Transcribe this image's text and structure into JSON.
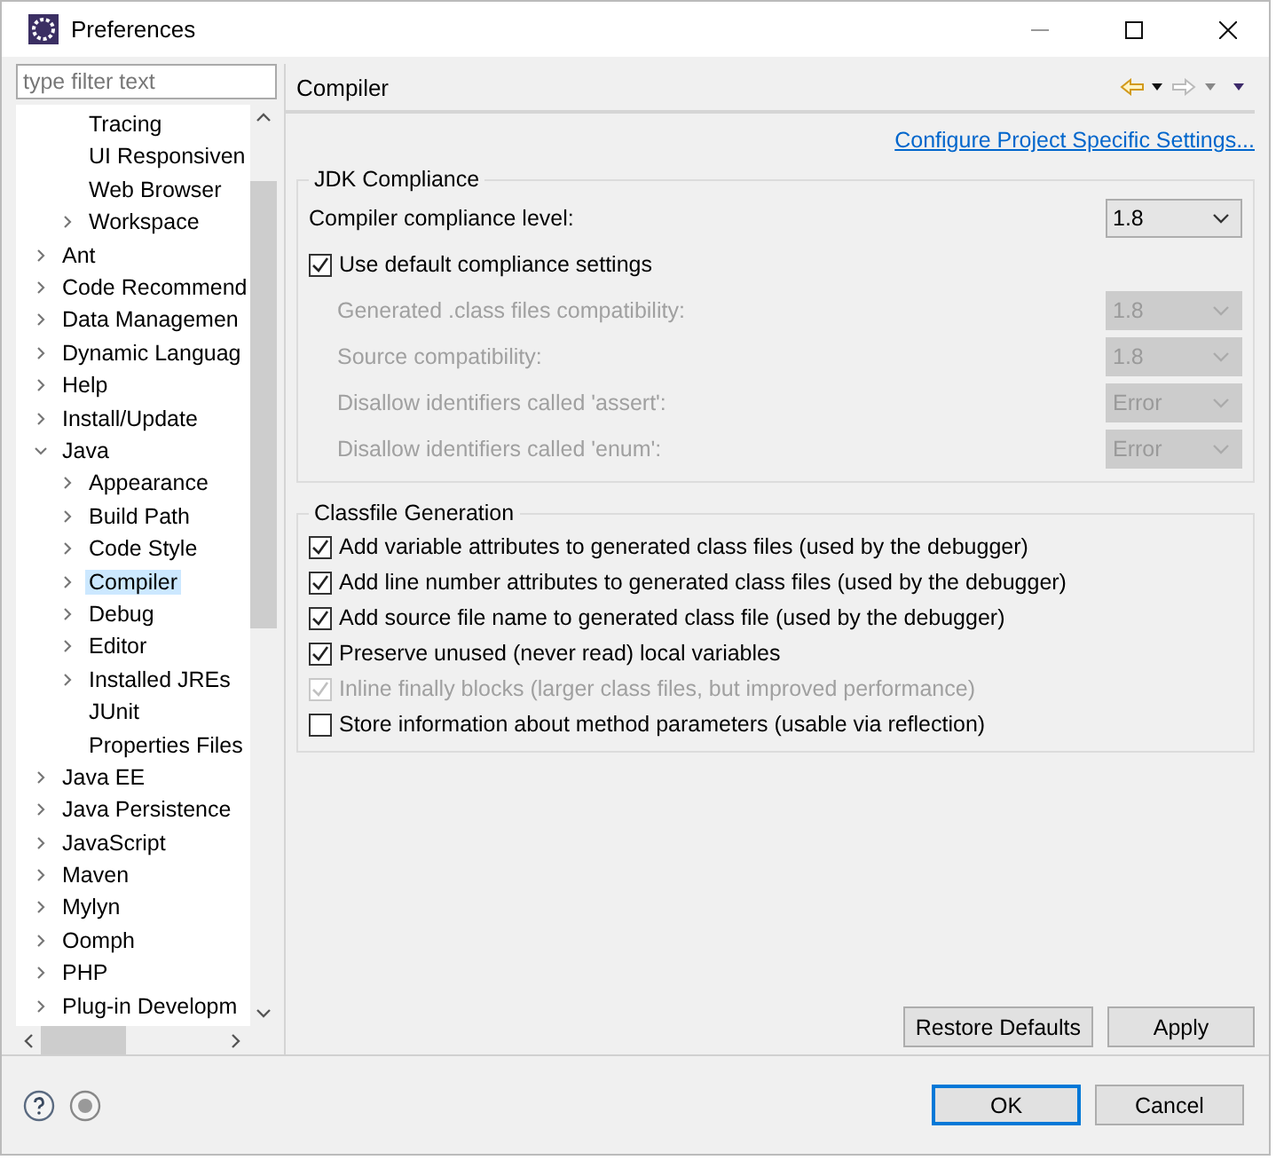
{
  "window": {
    "title": "Preferences"
  },
  "filter": {
    "placeholder": "type filter text"
  },
  "tree": {
    "scrolled_group_items": [
      {
        "label": "Tracing",
        "expandable": false,
        "selected": false
      },
      {
        "label": "UI Responsiven",
        "expandable": false,
        "selected": false
      },
      {
        "label": "Web Browser",
        "expandable": false,
        "selected": false
      },
      {
        "label": "Workspace",
        "expandable": true,
        "expanded": false,
        "selected": false
      }
    ],
    "items": [
      {
        "label": "Ant",
        "expandable": true,
        "expanded": false,
        "selected": false
      },
      {
        "label": "Code Recommend",
        "expandable": true,
        "expanded": false,
        "selected": false
      },
      {
        "label": "Data Managemen",
        "expandable": true,
        "expanded": false,
        "selected": false
      },
      {
        "label": "Dynamic Languag",
        "expandable": true,
        "expanded": false,
        "selected": false
      },
      {
        "label": "Help",
        "expandable": true,
        "expanded": false,
        "selected": false
      },
      {
        "label": "Install/Update",
        "expandable": true,
        "expanded": false,
        "selected": false
      },
      {
        "label": "Java",
        "expandable": true,
        "expanded": true,
        "selected": false,
        "children": [
          {
            "label": "Appearance",
            "expandable": true,
            "expanded": false,
            "selected": false
          },
          {
            "label": "Build Path",
            "expandable": true,
            "expanded": false,
            "selected": false
          },
          {
            "label": "Code Style",
            "expandable": true,
            "expanded": false,
            "selected": false
          },
          {
            "label": "Compiler",
            "expandable": true,
            "expanded": false,
            "selected": true
          },
          {
            "label": "Debug",
            "expandable": true,
            "expanded": false,
            "selected": false
          },
          {
            "label": "Editor",
            "expandable": true,
            "expanded": false,
            "selected": false
          },
          {
            "label": "Installed JREs",
            "expandable": true,
            "expanded": false,
            "selected": false
          },
          {
            "label": "JUnit",
            "expandable": false,
            "selected": false
          },
          {
            "label": "Properties Files",
            "expandable": false,
            "selected": false
          }
        ]
      },
      {
        "label": "Java EE",
        "expandable": true,
        "expanded": false,
        "selected": false
      },
      {
        "label": "Java Persistence",
        "expandable": true,
        "expanded": false,
        "selected": false
      },
      {
        "label": "JavaScript",
        "expandable": true,
        "expanded": false,
        "selected": false
      },
      {
        "label": "Maven",
        "expandable": true,
        "expanded": false,
        "selected": false
      },
      {
        "label": "Mylyn",
        "expandable": true,
        "expanded": false,
        "selected": false
      },
      {
        "label": "Oomph",
        "expandable": true,
        "expanded": false,
        "selected": false
      },
      {
        "label": "PHP",
        "expandable": true,
        "expanded": false,
        "selected": false
      },
      {
        "label": "Plug-in Developm",
        "expandable": true,
        "expanded": false,
        "selected": false
      }
    ]
  },
  "page": {
    "title": "Compiler",
    "link": "Configure Project Specific Settings...",
    "groups": [
      {
        "title": "JDK Compliance",
        "rows": [
          {
            "kind": "combo",
            "label": "Compiler compliance level:",
            "value": "1.8",
            "disabled": false
          },
          {
            "kind": "checkbox",
            "label": "Use default compliance settings",
            "checked": true,
            "disabled": false
          },
          {
            "kind": "combo",
            "label": "Generated .class files compatibility:",
            "value": "1.8",
            "disabled": true
          },
          {
            "kind": "combo",
            "label": "Source compatibility:",
            "value": "1.8",
            "disabled": true
          },
          {
            "kind": "combo",
            "label": "Disallow identifiers called 'assert':",
            "value": "Error",
            "disabled": true
          },
          {
            "kind": "combo",
            "label": "Disallow identifiers called 'enum':",
            "value": "Error",
            "disabled": true
          }
        ]
      },
      {
        "title": "Classfile Generation",
        "rows": [
          {
            "kind": "checkbox",
            "label": "Add variable attributes to generated class files (used by the debugger)",
            "checked": true,
            "disabled": false
          },
          {
            "kind": "checkbox",
            "label": "Add line number attributes to generated class files (used by the debugger)",
            "checked": true,
            "disabled": false
          },
          {
            "kind": "checkbox",
            "label": "Add source file name to generated class file (used by the debugger)",
            "checked": true,
            "disabled": false
          },
          {
            "kind": "checkbox",
            "label": "Preserve unused (never read) local variables",
            "checked": true,
            "disabled": false
          },
          {
            "kind": "checkbox",
            "label": "Inline finally blocks (larger class files, but improved performance)",
            "checked": true,
            "disabled": true
          },
          {
            "kind": "checkbox",
            "label": "Store information about method parameters (usable via reflection)",
            "checked": false,
            "disabled": false
          }
        ]
      }
    ],
    "buttons": [
      "Restore Defaults",
      "Apply"
    ]
  },
  "dialog_buttons": [
    {
      "label": "OK",
      "default": true
    },
    {
      "label": "Cancel",
      "default": false
    }
  ]
}
